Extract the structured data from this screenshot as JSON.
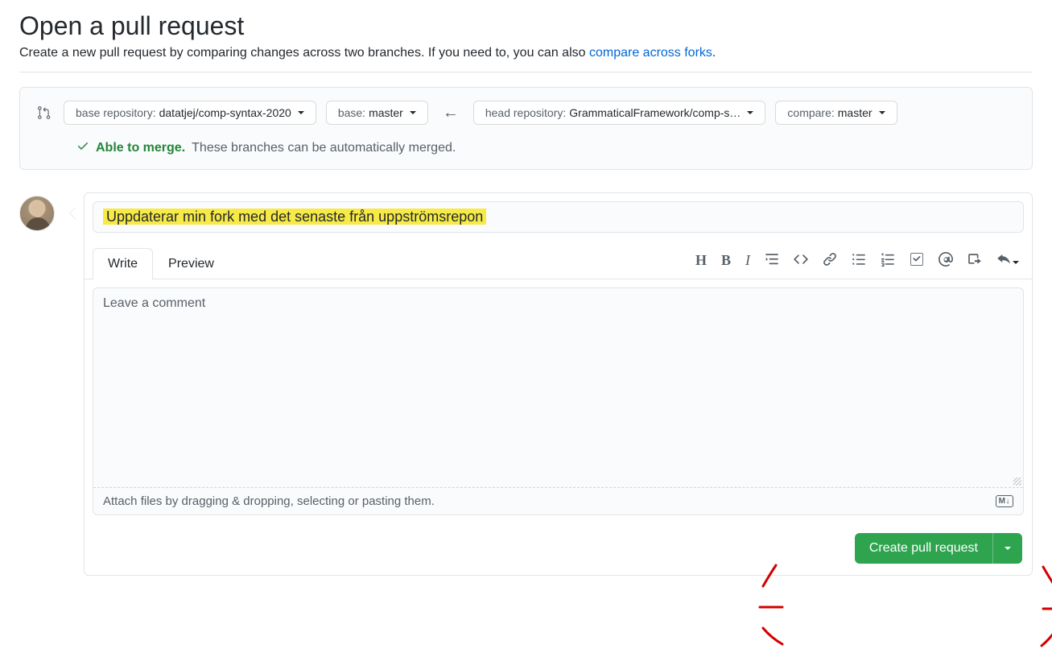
{
  "header": {
    "title": "Open a pull request",
    "subtitle_before": "Create a new pull request by comparing changes across two branches. If you need to, you can also ",
    "compare_link": "compare across forks",
    "subtitle_after": "."
  },
  "compare": {
    "base_repo_label": "base repository: ",
    "base_repo_value": "datatjej/comp-syntax-2020",
    "base_branch_label": "base: ",
    "base_branch_value": "master",
    "head_repo_label": "head repository: ",
    "head_repo_value": "GrammaticalFramework/comp-s…",
    "compare_branch_label": "compare: ",
    "compare_branch_value": "master",
    "able_text": "Able to merge.",
    "able_rest": "These branches can be automatically merged."
  },
  "pr": {
    "title": "Uppdaterar min fork med det senaste från uppströmsrepon",
    "write_tab": "Write",
    "preview_tab": "Preview",
    "comment_placeholder": "Leave a comment",
    "attach_hint": "Attach files by dragging & dropping, selecting or pasting them.",
    "md_badge": "M↓",
    "create_label": "Create pull request"
  }
}
